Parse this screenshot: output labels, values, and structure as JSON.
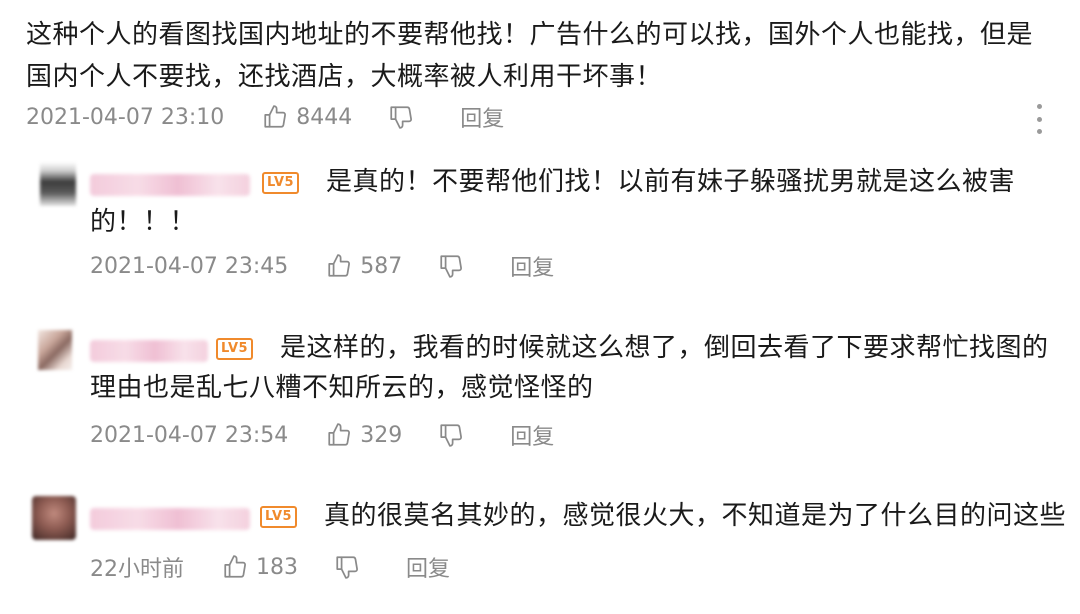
{
  "main_comment": {
    "text": "这种个人的看图找国内地址的不要帮他找！广告什么的可以找，国外个人也能找，但是国内个人不要找，还找酒店，大概率被人利用干坏事！",
    "time": "2021-04-07 23:10",
    "likes": "8444",
    "reply_label": "回复"
  },
  "replies": [
    {
      "level": "LV5",
      "text": "是真的！不要帮他们找！以前有妹子躲骚扰男就是这么被害的！！！",
      "time": "2021-04-07 23:45",
      "likes": "587",
      "reply_label": "回复"
    },
    {
      "level": "LV5",
      "text": "是这样的，我看的时候就这么想了，倒回去看了下要求帮忙找图的理由也是乱七八糟不知所云的，感觉怪怪的",
      "time": "2021-04-07 23:54",
      "likes": "329",
      "reply_label": "回复"
    },
    {
      "level": "LV5",
      "text": "真的很莫名其妙的，感觉很火大，不知道是为了什么目的问这些",
      "time": "22小时前",
      "likes": "183",
      "reply_label": "回复"
    }
  ],
  "colors": {
    "text": "#1a1a1a",
    "meta": "#8a8a8a",
    "level_badge": "#f08a2c",
    "name_blur": "#f2c6d8"
  },
  "icons": [
    "thumbs-up-icon",
    "thumbs-down-icon",
    "more-vertical-icon"
  ]
}
